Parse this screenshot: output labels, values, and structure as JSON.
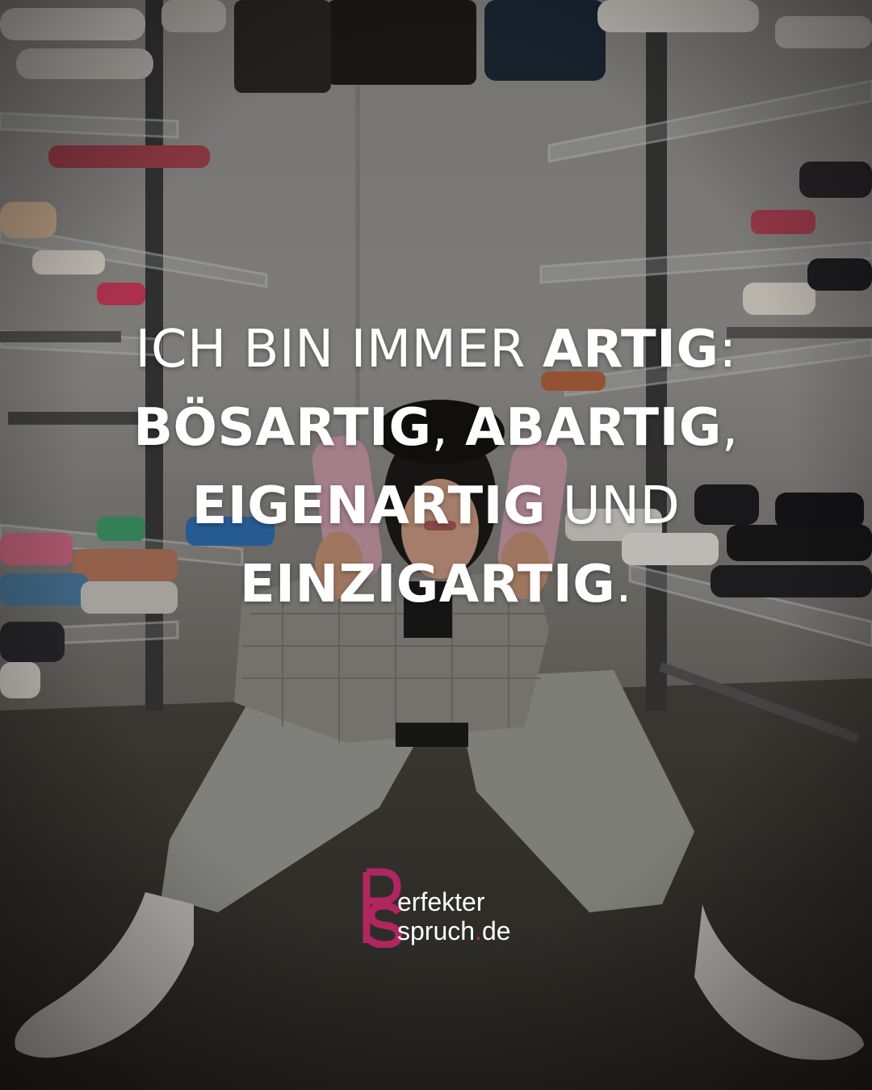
{
  "quote": {
    "lines": [
      [
        {
          "text": "ICH BIN IMMER ",
          "weight": "light"
        },
        {
          "text": "ARTIG",
          "weight": "bold"
        },
        {
          "text": ":",
          "weight": "light"
        }
      ],
      [
        {
          "text": "BÖSARTIG",
          "weight": "bold"
        },
        {
          "text": ", ",
          "weight": "light"
        },
        {
          "text": "ABARTIG",
          "weight": "bold"
        },
        {
          "text": ",",
          "weight": "light"
        }
      ],
      [
        {
          "text": "EIGENARTIG",
          "weight": "bold"
        },
        {
          "text": " UND",
          "weight": "light"
        }
      ],
      [
        {
          "text": "EINZIGARTIG",
          "weight": "bold"
        },
        {
          "text": ".",
          "weight": "light"
        }
      ]
    ],
    "color": "#ffffff"
  },
  "logo": {
    "word_1": "erfekter",
    "word_2": "spruch",
    "dot": ".",
    "tld": "de",
    "brand_color": "#b0265e",
    "icon": "ps-monogram-icon"
  },
  "photo": {
    "description_icon": "person-in-shoe-aisle-photo"
  }
}
